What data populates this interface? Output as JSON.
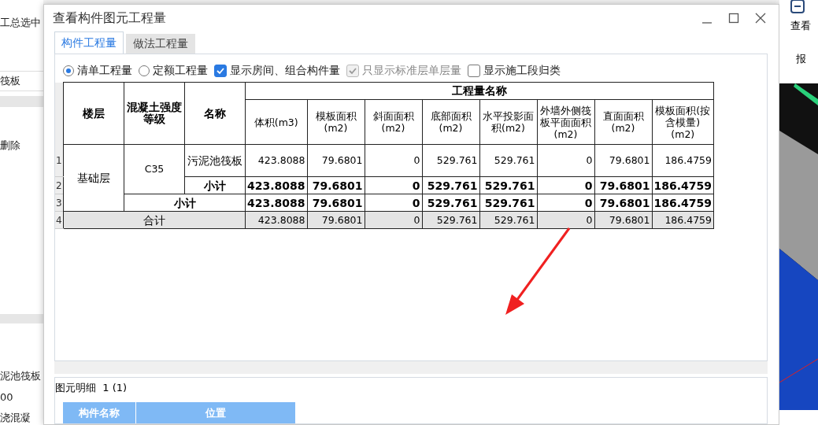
{
  "background_app": {
    "left_labels": [
      "工总选中",
      "筏板",
      "删除",
      "泥池筏板",
      "00",
      "浇混凝"
    ],
    "right_labels": [
      "查看",
      "报"
    ]
  },
  "window": {
    "title": "查看构件图元工程量"
  },
  "tabs": [
    {
      "label": "构件工程量",
      "selected": true
    },
    {
      "label": "做法工程量",
      "selected": false
    }
  ],
  "options": [
    {
      "kind": "radio",
      "label": "清单工程量",
      "selected": true,
      "disabled": false
    },
    {
      "kind": "radio",
      "label": "定额工程量",
      "selected": false,
      "disabled": false
    },
    {
      "kind": "checkbox",
      "label": "显示房间、组合构件量",
      "checked": true,
      "disabled": false
    },
    {
      "kind": "checkbox",
      "label": "只显示标准层单层量",
      "checked": true,
      "disabled": true
    },
    {
      "kind": "checkbox",
      "label": "显示施工段归类",
      "checked": false,
      "disabled": false
    }
  ],
  "table": {
    "group_header": "工程量名称",
    "key_columns": [
      "楼层",
      "混凝土强度等级",
      "名称"
    ],
    "value_columns": [
      "体积(m3)",
      "模板面积(m2)",
      "斜面面积(m2)",
      "底部面积(m2)",
      "水平投影面积(m2)",
      "外墙外侧筏板平面面积(m2)",
      "直面面积(m2)",
      "模板面积(按含模量)(m2)"
    ],
    "rows": [
      {
        "row_number": "1",
        "kind": "item",
        "floor": "基础层",
        "grade": "C35",
        "name": "污泥池筏板",
        "values": [
          "423.8088",
          "79.6801",
          "0",
          "529.761",
          "529.761",
          "0",
          "79.6801",
          "186.4759"
        ]
      },
      {
        "row_number": "2",
        "kind": "subtotal",
        "label": "小计",
        "values": [
          "423.8088",
          "79.6801",
          "0",
          "529.761",
          "529.761",
          "0",
          "79.6801",
          "186.4759"
        ]
      },
      {
        "row_number": "3",
        "kind": "floor_subtotal",
        "label": "小计",
        "values": [
          "423.8088",
          "79.6801",
          "0",
          "529.761",
          "529.761",
          "0",
          "79.6801",
          "186.4759"
        ]
      },
      {
        "row_number": "4",
        "kind": "total",
        "label": "合计",
        "values": [
          "423.8088",
          "79.6801",
          "0",
          "529.761",
          "529.761",
          "0",
          "79.6801",
          "186.4759"
        ]
      }
    ]
  },
  "detail_panel": {
    "title": "图元明细",
    "count": "1 (1)",
    "columns": [
      "构件名称",
      "位置"
    ]
  }
}
